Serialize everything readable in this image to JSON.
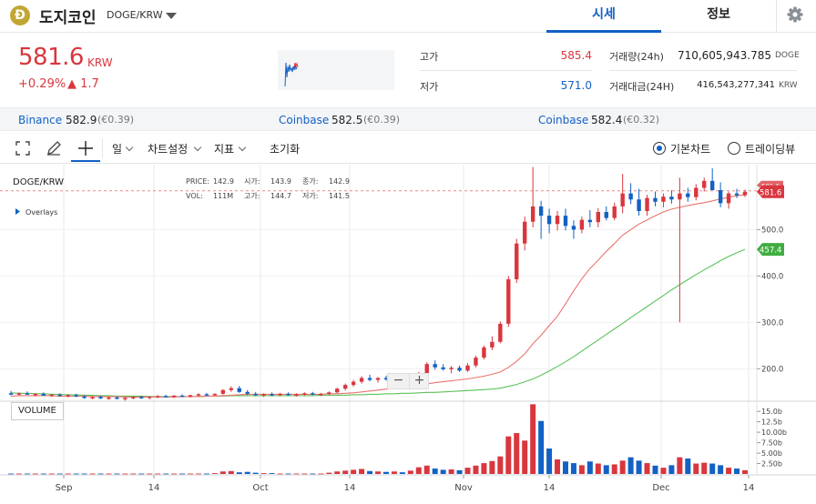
{
  "header": {
    "coin_symbol_letter": "Ð",
    "coin_name": "도지코인",
    "pair": "DOGE/KRW",
    "tabs": [
      {
        "label": "시세",
        "active": true
      },
      {
        "label": "정보",
        "active": false
      }
    ],
    "icons": {
      "settings": "gear-icon",
      "dropdown": "caret-down-icon"
    }
  },
  "summary": {
    "price": "581.6",
    "unit": "KRW",
    "change_pct": "+0.29%",
    "change_abs": "▲ 1.7",
    "stats": {
      "high_label": "고가",
      "high_value": "585.4",
      "low_label": "저가",
      "low_value": "571.0",
      "volume_label": "거래량(24h)",
      "volume_value": "710,605,943.785",
      "volume_unit": "DOGE",
      "amount_label": "거래대금(24H)",
      "amount_value": "416,543,277,341",
      "amount_unit": "KRW"
    }
  },
  "exchanges": [
    {
      "name": "Binance",
      "price": "582.9",
      "diff": "(€0.39)"
    },
    {
      "name": "Coinbase",
      "price": "582.5",
      "diff": "(€0.39)"
    },
    {
      "name": "Coinbase",
      "price": "582.4",
      "diff": "(€0.32)"
    }
  ],
  "toolbar": {
    "interval": "일",
    "chart_settings": "차트설정",
    "indicators": "지표",
    "reset": "초기화",
    "view_basic": "기본차트",
    "view_trading": "트레이딩뷰",
    "icons": {
      "fullscreen": "fullscreen-icon",
      "draw": "pencil-icon",
      "crosshair": "crosshair-icon"
    }
  },
  "chart_overlay": {
    "symbol": "DOGE/KRW",
    "overlays_label": "Overlays",
    "price_label": "PRICE:",
    "price_value": "142.9",
    "open_label": "시가:",
    "open_value": "143.9",
    "close_label": "종가:",
    "close_value": "142.9",
    "vol_label": "VOL:",
    "vol_value": "111M",
    "high_label": "고가:",
    "high_value": "144.7",
    "low_label": "저가:",
    "low_value": "141.5",
    "volume_panel_label": "VOLUME",
    "current_price_tag": "581.6",
    "ma_tag": "457.4",
    "hidden_tag": "581.6",
    "zoom_out": "−",
    "zoom_in": "+"
  },
  "colors": {
    "up": "#d9363e",
    "down": "#1261c4",
    "ma_short": "#e8746e",
    "ma_long": "#5cc25a",
    "accent": "#1261c4"
  },
  "chart_data": {
    "type": "candlestick",
    "x_tick_labels": [
      "Sep",
      "14",
      "Oct",
      "14",
      "Nov",
      "14",
      "Dec",
      "14"
    ],
    "y_tick_labels": [
      "200.0",
      "300.0",
      "400.0",
      "500.0"
    ],
    "ylim": [
      130,
      640
    ],
    "volume_tick_labels": [
      "2.50b",
      "5.00b",
      "7.50b",
      "10.00b",
      "12.5b",
      "15.0b"
    ],
    "volume_ylim_b": [
      0,
      17
    ],
    "candles": [
      {
        "o": 147,
        "h": 152,
        "l": 143,
        "c": 145,
        "v": 0.1
      },
      {
        "o": 145,
        "h": 149,
        "l": 142,
        "c": 147,
        "v": 0.1
      },
      {
        "o": 147,
        "h": 151,
        "l": 144,
        "c": 144,
        "v": 0.1
      },
      {
        "o": 144,
        "h": 147,
        "l": 140,
        "c": 146,
        "v": 0.1
      },
      {
        "o": 146,
        "h": 149,
        "l": 142,
        "c": 142,
        "v": 0.1
      },
      {
        "o": 142,
        "h": 146,
        "l": 139,
        "c": 144,
        "v": 0.1
      },
      {
        "o": 144,
        "h": 147,
        "l": 140,
        "c": 141,
        "v": 0.1
      },
      {
        "o": 141,
        "h": 145,
        "l": 138,
        "c": 143,
        "v": 0.1
      },
      {
        "o": 143,
        "h": 146,
        "l": 139,
        "c": 140,
        "v": 0.1
      },
      {
        "o": 140,
        "h": 143,
        "l": 135,
        "c": 137,
        "v": 0.1
      },
      {
        "o": 137,
        "h": 141,
        "l": 134,
        "c": 139,
        "v": 0.1
      },
      {
        "o": 139,
        "h": 142,
        "l": 135,
        "c": 136,
        "v": 0.1
      },
      {
        "o": 136,
        "h": 140,
        "l": 133,
        "c": 138,
        "v": 0.1
      },
      {
        "o": 138,
        "h": 141,
        "l": 134,
        "c": 135,
        "v": 0.1
      },
      {
        "o": 135,
        "h": 139,
        "l": 131,
        "c": 137,
        "v": 0.1
      },
      {
        "o": 137,
        "h": 141,
        "l": 134,
        "c": 139,
        "v": 0.1
      },
      {
        "o": 139,
        "h": 142,
        "l": 135,
        "c": 137,
        "v": 0.1
      },
      {
        "o": 137,
        "h": 141,
        "l": 134,
        "c": 140,
        "v": 0.1
      },
      {
        "o": 140,
        "h": 143,
        "l": 137,
        "c": 141,
        "v": 0.1
      },
      {
        "o": 141,
        "h": 144,
        "l": 138,
        "c": 139,
        "v": 0.1
      },
      {
        "o": 139,
        "h": 143,
        "l": 137,
        "c": 142,
        "v": 0.1
      },
      {
        "o": 142,
        "h": 145,
        "l": 139,
        "c": 140,
        "v": 0.1
      },
      {
        "o": 140,
        "h": 144,
        "l": 138,
        "c": 143,
        "v": 0.1
      },
      {
        "o": 143,
        "h": 147,
        "l": 140,
        "c": 145,
        "v": 0.1
      },
      {
        "o": 145,
        "h": 148,
        "l": 142,
        "c": 143,
        "v": 0.1
      },
      {
        "o": 143,
        "h": 147,
        "l": 141,
        "c": 146,
        "v": 0.2
      },
      {
        "o": 146,
        "h": 156,
        "l": 144,
        "c": 154,
        "v": 0.6
      },
      {
        "o": 154,
        "h": 162,
        "l": 150,
        "c": 158,
        "v": 0.7
      },
      {
        "o": 158,
        "h": 163,
        "l": 148,
        "c": 150,
        "v": 0.4
      },
      {
        "o": 150,
        "h": 154,
        "l": 143,
        "c": 146,
        "v": 0.5
      },
      {
        "o": 146,
        "h": 150,
        "l": 141,
        "c": 143,
        "v": 0.3
      },
      {
        "o": 143,
        "h": 147,
        "l": 139,
        "c": 145,
        "v": 0.2
      },
      {
        "o": 145,
        "h": 149,
        "l": 141,
        "c": 144,
        "v": 0.2
      },
      {
        "o": 144,
        "h": 148,
        "l": 141,
        "c": 146,
        "v": 0.1
      },
      {
        "o": 146,
        "h": 149,
        "l": 142,
        "c": 143,
        "v": 0.1
      },
      {
        "o": 143,
        "h": 147,
        "l": 140,
        "c": 145,
        "v": 0.1
      },
      {
        "o": 145,
        "h": 149,
        "l": 142,
        "c": 147,
        "v": 0.1
      },
      {
        "o": 147,
        "h": 150,
        "l": 143,
        "c": 144,
        "v": 0.1
      },
      {
        "o": 144,
        "h": 148,
        "l": 141,
        "c": 146,
        "v": 0.1
      },
      {
        "o": 146,
        "h": 151,
        "l": 143,
        "c": 149,
        "v": 0.3
      },
      {
        "o": 149,
        "h": 159,
        "l": 147,
        "c": 157,
        "v": 0.6
      },
      {
        "o": 157,
        "h": 168,
        "l": 153,
        "c": 165,
        "v": 0.8
      },
      {
        "o": 165,
        "h": 176,
        "l": 161,
        "c": 172,
        "v": 1.0
      },
      {
        "o": 172,
        "h": 184,
        "l": 168,
        "c": 180,
        "v": 1.2
      },
      {
        "o": 180,
        "h": 187,
        "l": 173,
        "c": 176,
        "v": 0.7
      },
      {
        "o": 176,
        "h": 182,
        "l": 170,
        "c": 180,
        "v": 0.6
      },
      {
        "o": 180,
        "h": 185,
        "l": 174,
        "c": 177,
        "v": 0.5
      },
      {
        "o": 177,
        "h": 183,
        "l": 171,
        "c": 181,
        "v": 0.6
      },
      {
        "o": 181,
        "h": 185,
        "l": 175,
        "c": 178,
        "v": 0.4
      },
      {
        "o": 178,
        "h": 186,
        "l": 176,
        "c": 184,
        "v": 0.8
      },
      {
        "o": 184,
        "h": 193,
        "l": 180,
        "c": 190,
        "v": 1.6
      },
      {
        "o": 190,
        "h": 214,
        "l": 186,
        "c": 210,
        "v": 2.0
      },
      {
        "o": 210,
        "h": 218,
        "l": 198,
        "c": 203,
        "v": 1.3
      },
      {
        "o": 203,
        "h": 210,
        "l": 196,
        "c": 199,
        "v": 1.0
      },
      {
        "o": 199,
        "h": 206,
        "l": 190,
        "c": 202,
        "v": 1.1
      },
      {
        "o": 202,
        "h": 207,
        "l": 193,
        "c": 196,
        "v": 0.9
      },
      {
        "o": 196,
        "h": 212,
        "l": 193,
        "c": 207,
        "v": 1.5
      },
      {
        "o": 207,
        "h": 228,
        "l": 203,
        "c": 224,
        "v": 2.0
      },
      {
        "o": 224,
        "h": 250,
        "l": 220,
        "c": 246,
        "v": 2.6
      },
      {
        "o": 246,
        "h": 270,
        "l": 240,
        "c": 258,
        "v": 3.1
      },
      {
        "o": 258,
        "h": 302,
        "l": 255,
        "c": 297,
        "v": 4.2
      },
      {
        "o": 297,
        "h": 400,
        "l": 290,
        "c": 393,
        "v": 9.0
      },
      {
        "o": 393,
        "h": 480,
        "l": 385,
        "c": 470,
        "v": 9.8
      },
      {
        "o": 470,
        "h": 528,
        "l": 455,
        "c": 517,
        "v": 8.0
      },
      {
        "o": 517,
        "h": 635,
        "l": 505,
        "c": 550,
        "v": 16.7
      },
      {
        "o": 550,
        "h": 562,
        "l": 480,
        "c": 530,
        "v": 12.7
      },
      {
        "o": 530,
        "h": 545,
        "l": 492,
        "c": 512,
        "v": 6.1
      },
      {
        "o": 512,
        "h": 540,
        "l": 498,
        "c": 530,
        "v": 3.5
      },
      {
        "o": 530,
        "h": 545,
        "l": 498,
        "c": 508,
        "v": 3.0
      },
      {
        "o": 508,
        "h": 520,
        "l": 480,
        "c": 500,
        "v": 2.6
      },
      {
        "o": 500,
        "h": 528,
        "l": 492,
        "c": 521,
        "v": 2.1
      },
      {
        "o": 521,
        "h": 542,
        "l": 505,
        "c": 516,
        "v": 3.0
      },
      {
        "o": 516,
        "h": 546,
        "l": 505,
        "c": 538,
        "v": 2.5
      },
      {
        "o": 538,
        "h": 550,
        "l": 520,
        "c": 525,
        "v": 2.1
      },
      {
        "o": 525,
        "h": 558,
        "l": 520,
        "c": 550,
        "v": 2.3
      },
      {
        "o": 550,
        "h": 620,
        "l": 535,
        "c": 578,
        "v": 3.2
      },
      {
        "o": 578,
        "h": 600,
        "l": 555,
        "c": 565,
        "v": 4.0
      },
      {
        "o": 565,
        "h": 588,
        "l": 530,
        "c": 540,
        "v": 3.2
      },
      {
        "o": 540,
        "h": 575,
        "l": 530,
        "c": 568,
        "v": 2.6
      },
      {
        "o": 568,
        "h": 582,
        "l": 550,
        "c": 560,
        "v": 2.0
      },
      {
        "o": 560,
        "h": 578,
        "l": 548,
        "c": 571,
        "v": 1.5
      },
      {
        "o": 571,
        "h": 585,
        "l": 556,
        "c": 565,
        "v": 2.1
      },
      {
        "o": 565,
        "h": 612,
        "l": 300,
        "c": 578,
        "v": 4.0
      },
      {
        "o": 578,
        "h": 590,
        "l": 560,
        "c": 570,
        "v": 3.7
      },
      {
        "o": 570,
        "h": 598,
        "l": 563,
        "c": 590,
        "v": 2.5
      },
      {
        "o": 590,
        "h": 612,
        "l": 582,
        "c": 605,
        "v": 2.7
      },
      {
        "o": 605,
        "h": 632,
        "l": 595,
        "c": 585,
        "v": 2.5
      },
      {
        "o": 585,
        "h": 602,
        "l": 548,
        "c": 557,
        "v": 2.1
      },
      {
        "o": 557,
        "h": 582,
        "l": 545,
        "c": 578,
        "v": 1.5
      },
      {
        "o": 578,
        "h": 588,
        "l": 568,
        "c": 574,
        "v": 1.3
      },
      {
        "o": 574,
        "h": 586,
        "l": 570,
        "c": 581.6,
        "v": 0.9
      }
    ],
    "ma_short": [
      141,
      142,
      142,
      142,
      142,
      142,
      141,
      141,
      141,
      141,
      140,
      140,
      140,
      140,
      139,
      139,
      139,
      139,
      139,
      139,
      139,
      140,
      140,
      140,
      141,
      141,
      142,
      143,
      144,
      145,
      145,
      145,
      145,
      145,
      145,
      145,
      145,
      145,
      145,
      146,
      146,
      147,
      148,
      150,
      152,
      154,
      156,
      158,
      160,
      162,
      164,
      167,
      170,
      172,
      174,
      176,
      178,
      181,
      184,
      188,
      193,
      203,
      216,
      232,
      254,
      272,
      293,
      313,
      340,
      368,
      394,
      416,
      434,
      453,
      470,
      488,
      500,
      512,
      521,
      530,
      538,
      544,
      548,
      552,
      555,
      558,
      562,
      566,
      570,
      573,
      575
    ],
    "ma_long": [
      148,
      147,
      147,
      146,
      146,
      145,
      145,
      144,
      144,
      143,
      143,
      142,
      142,
      141,
      141,
      141,
      141,
      140,
      140,
      140,
      140,
      140,
      140,
      140,
      141,
      141,
      141,
      142,
      142,
      142,
      142,
      142,
      142,
      142,
      142,
      142,
      142,
      142,
      143,
      143,
      143,
      143,
      144,
      144,
      145,
      145,
      146,
      146,
      147,
      147,
      148,
      149,
      149,
      150,
      151,
      152,
      153,
      154,
      155,
      156,
      158,
      162,
      166,
      172,
      178,
      186,
      195,
      205,
      215,
      226,
      238,
      250,
      262,
      274,
      286,
      298,
      310,
      322,
      334,
      346,
      358,
      370,
      381,
      392,
      403,
      413,
      423,
      433,
      442,
      450,
      457.4
    ]
  }
}
